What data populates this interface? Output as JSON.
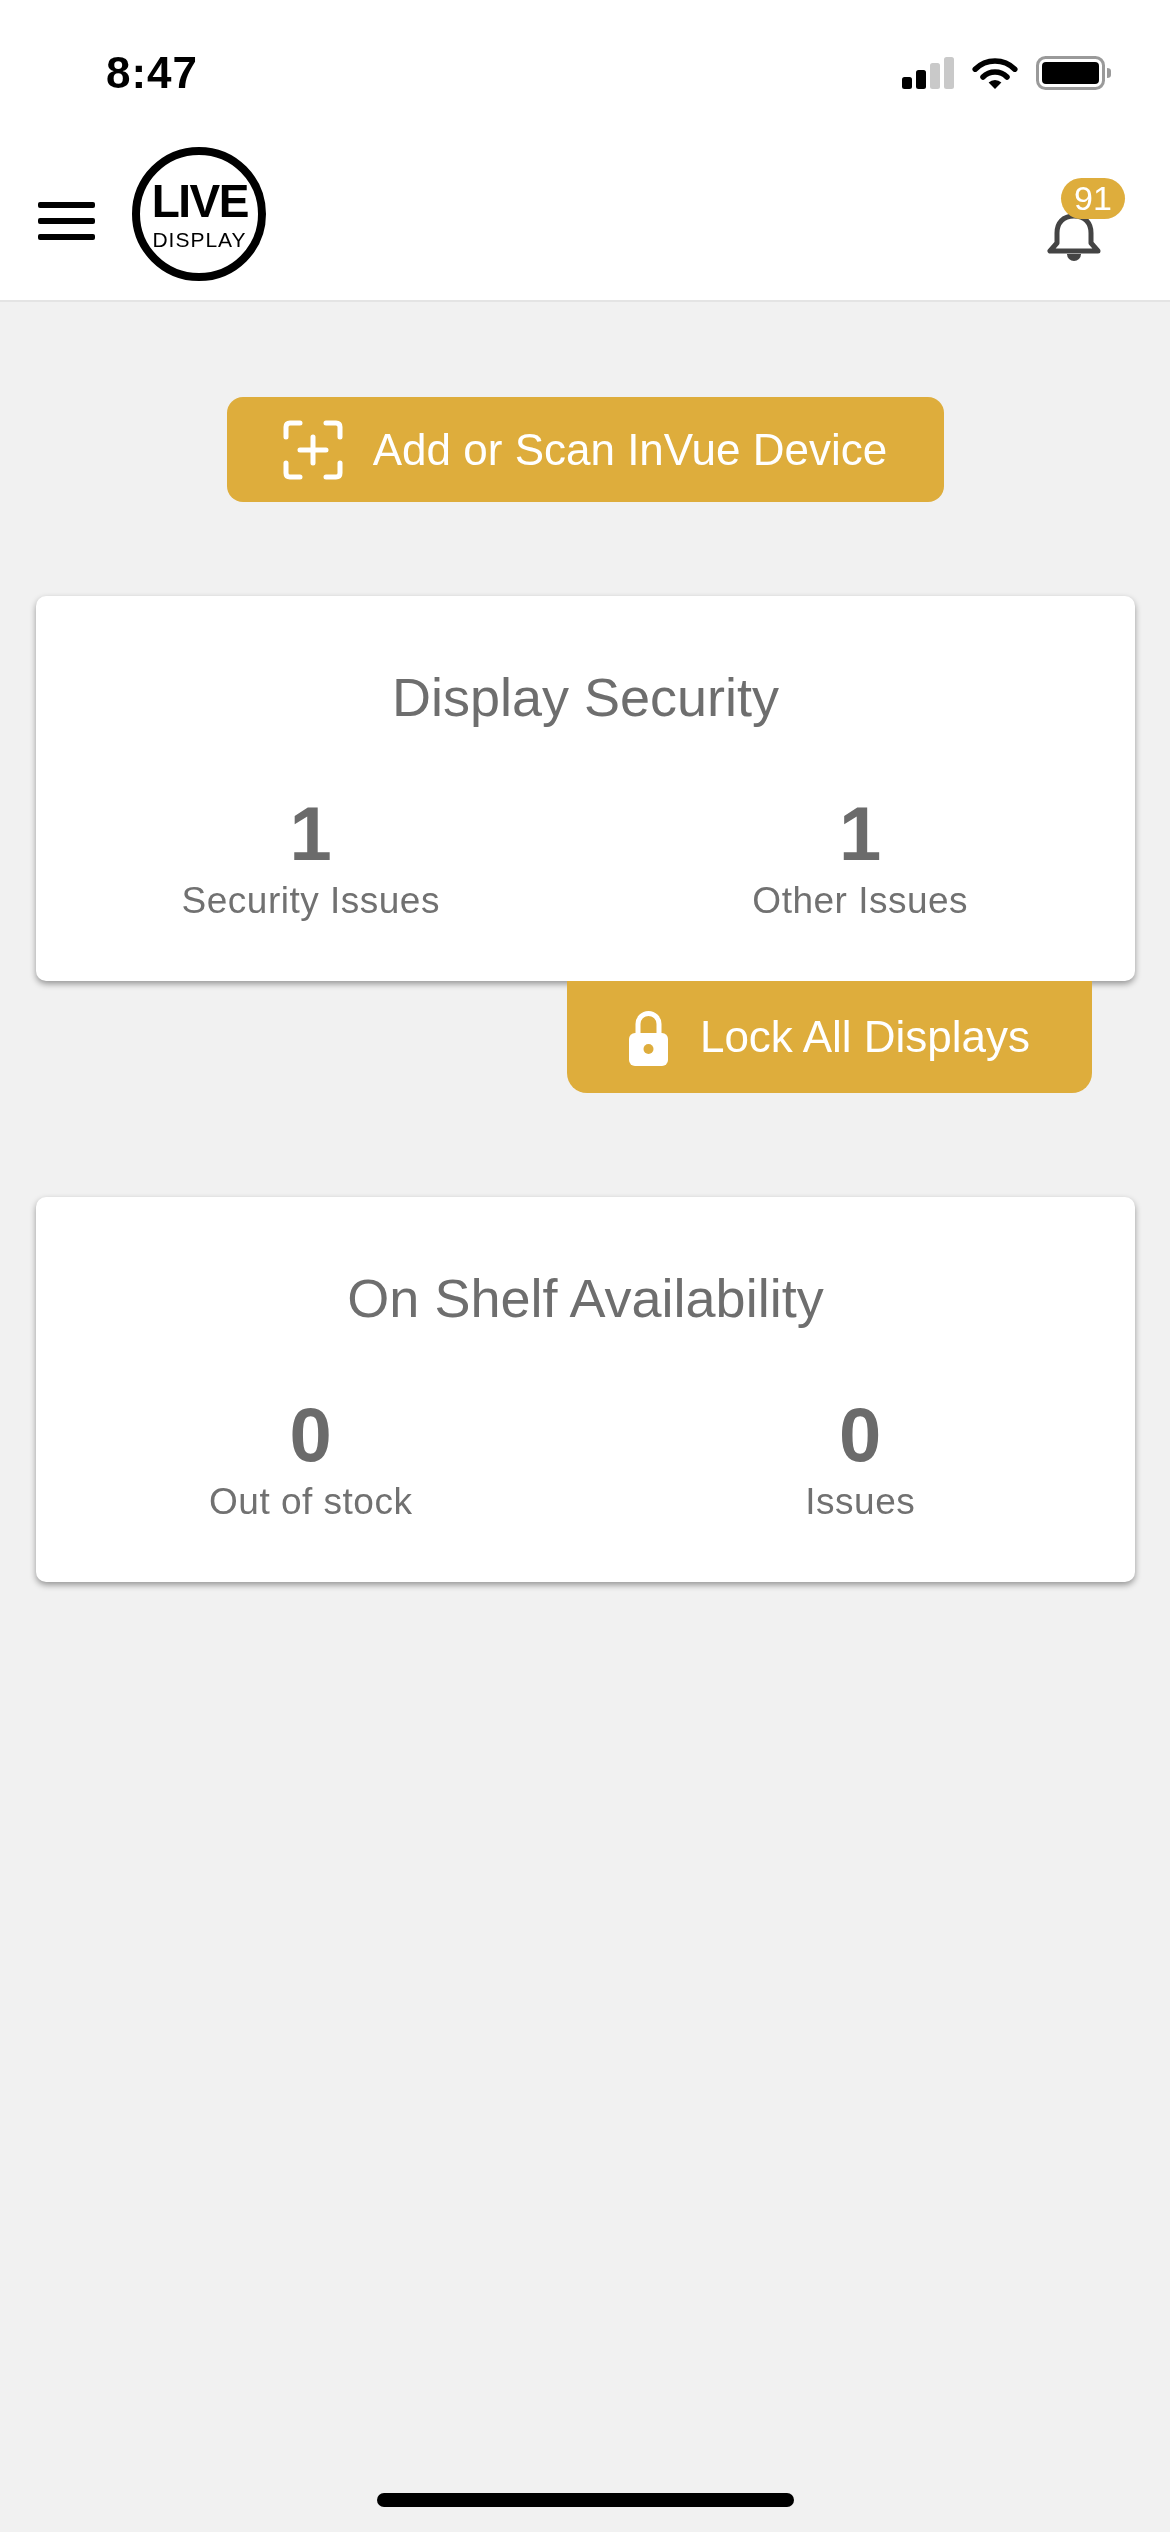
{
  "status_bar": {
    "time": "8:47"
  },
  "header": {
    "logo": {
      "wordmark": "LIVE",
      "tagline": "DISPLAY"
    },
    "notifications": {
      "badge": "91"
    }
  },
  "add_device_button": {
    "label": "Add or Scan InVue Device"
  },
  "cards": [
    {
      "title": "Display Security",
      "stats": [
        {
          "value": "1",
          "label": "Security Issues"
        },
        {
          "value": "1",
          "label": "Other Issues"
        }
      ],
      "action": {
        "kind": "lock",
        "label": "Lock All Displays"
      }
    },
    {
      "title": "On Shelf Availability",
      "stats": [
        {
          "value": "0",
          "label": "Out of stock"
        },
        {
          "value": "0",
          "label": "Issues"
        }
      ]
    }
  ]
}
